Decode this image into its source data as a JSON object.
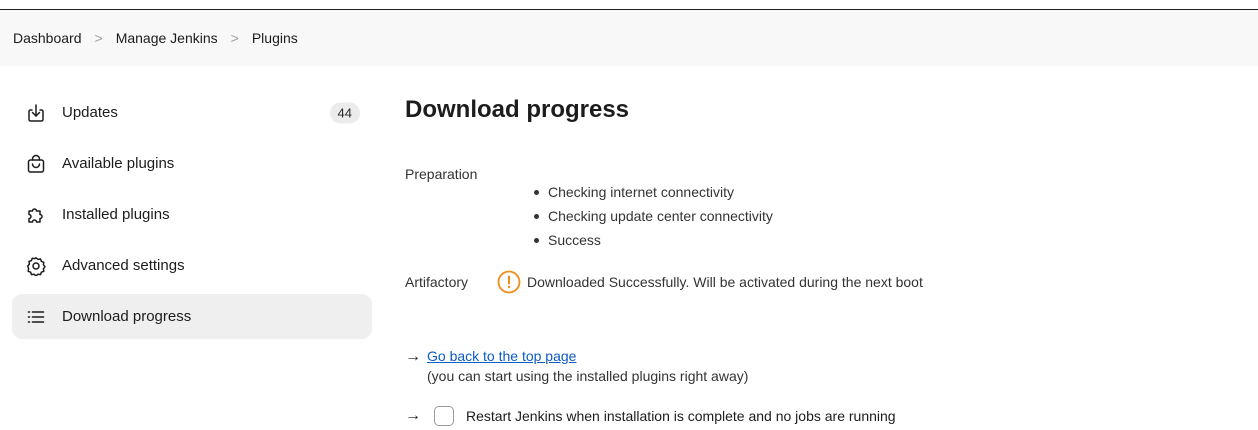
{
  "breadcrumb": {
    "items": [
      "Dashboard",
      "Manage Jenkins",
      "Plugins"
    ],
    "separator": ">"
  },
  "sidebar": {
    "items": [
      {
        "label": "Updates",
        "icon": "download-icon",
        "badge": "44"
      },
      {
        "label": "Available plugins",
        "icon": "shopping-bag-icon"
      },
      {
        "label": "Installed plugins",
        "icon": "puzzle-piece-icon"
      },
      {
        "label": "Advanced settings",
        "icon": "gear-icon"
      },
      {
        "label": "Download progress",
        "icon": "list-icon",
        "active": true
      }
    ]
  },
  "main": {
    "title": "Download progress",
    "preparation": {
      "label": "Preparation",
      "steps": [
        "Checking internet connectivity",
        "Checking update center connectivity",
        "Success"
      ]
    },
    "artifactory": {
      "label": "Artifactory",
      "status_icon": "warning-icon",
      "status_text": "Downloaded Successfully. Will be activated during the next boot"
    },
    "top_link": {
      "label": "Go back to the top page",
      "hint": "(you can start using the installed plugins right away)"
    },
    "restart": {
      "label": "Restart Jenkins when installation is complete and no jobs are running",
      "checked": false
    }
  },
  "colors": {
    "link": "#0b5cc4",
    "warning": "#f08c1a",
    "active_item_bg": "#efefef"
  }
}
